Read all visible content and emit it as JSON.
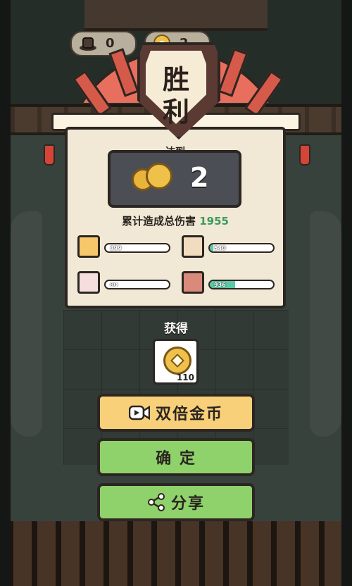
{
  "resources": [
    {
      "icon": "hat-icon",
      "value": "0"
    },
    {
      "icon": "coin-icon",
      "value": "2"
    }
  ],
  "victory": {
    "title_line1": "胜",
    "title_line2": "利"
  },
  "reach": {
    "label": "达到",
    "value": "2"
  },
  "damage": {
    "label": "累计造成总伤害",
    "value": "1955"
  },
  "heroes": [
    {
      "name": "monkey-hero",
      "value": "399",
      "fill": 0.0
    },
    {
      "name": "monk-hero",
      "value": "540",
      "fill": 0.05
    },
    {
      "name": "pig-hero",
      "value": "80",
      "fill": 0.0
    },
    {
      "name": "sand-monk-hero",
      "value": "936",
      "fill": 0.4
    }
  ],
  "obtain": {
    "label": "获得",
    "amount": "110"
  },
  "buttons": {
    "double": "双倍金币",
    "confirm": "确 定",
    "share": "分享"
  },
  "colors": {
    "green": "#8fd16a",
    "gold": "#f8d07a",
    "panel": "#f1e9d6"
  }
}
